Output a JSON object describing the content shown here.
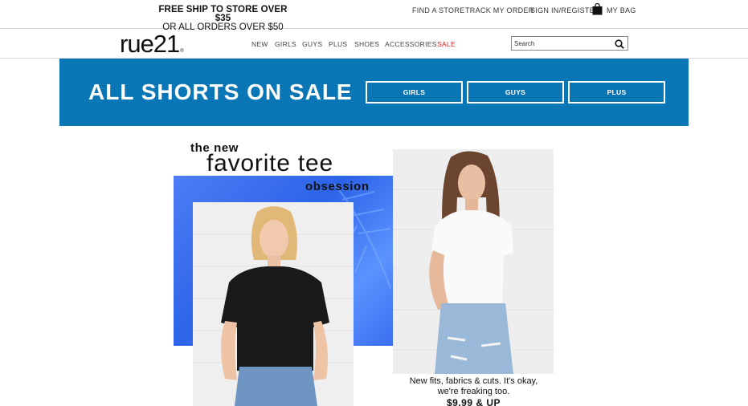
{
  "topbar": {
    "promo_line1": "FREE SHIP TO STORE OVER $35",
    "promo_line2": "OR ALL ORDERS OVER $50",
    "find_store": "FIND A STORE",
    "track_order": "TRACK MY ORDER",
    "sign_in": "SIGN IN/REGISTER",
    "bag": "MY BAG",
    "bag_icon": "shopping-bag-icon"
  },
  "nav": {
    "logo": "rue21",
    "logo_mark": "®",
    "items": [
      "NEW",
      "GIRLS",
      "GUYS",
      "PLUS",
      "SHOES",
      "ACCESSORIES",
      "SALE"
    ],
    "sale_color": "#e02020",
    "search_placeholder": "Search",
    "search_icon": "search-icon"
  },
  "banner": {
    "title": "ALL SHORTS ON SALE",
    "background": "#0a76b6",
    "buttons": [
      "GIRLS",
      "GUYS",
      "PLUS"
    ]
  },
  "promo": {
    "headline_1": "the new",
    "headline_2": "favorite tee",
    "headline_3": "obsession",
    "caption": "New fits, fabrics & cuts. It's okay, we're freaking too.",
    "price": "$9.99 & UP"
  }
}
